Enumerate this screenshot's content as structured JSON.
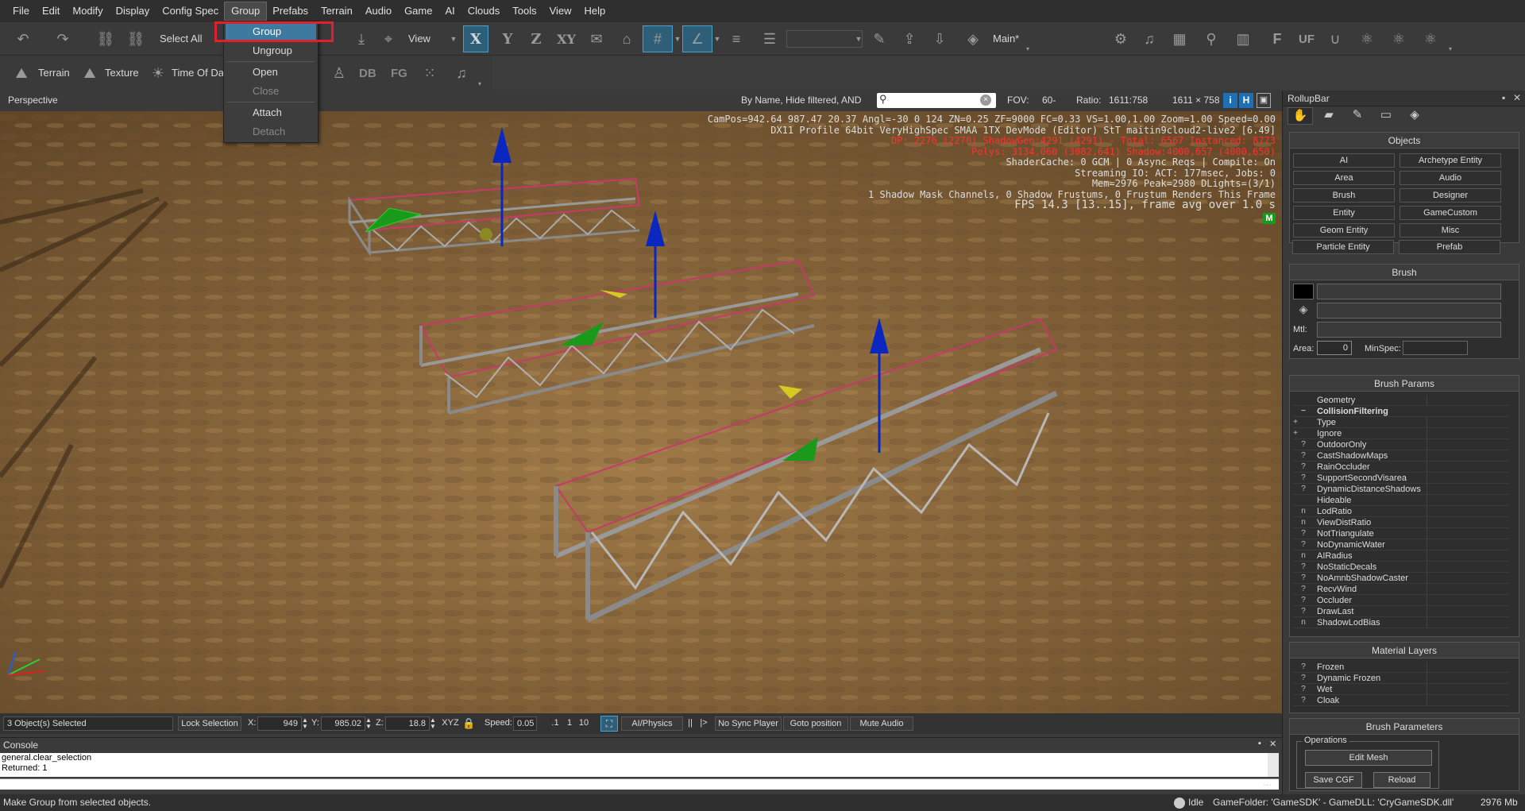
{
  "menubar": {
    "items": [
      "File",
      "Edit",
      "Modify",
      "Display",
      "Config Spec",
      "Group",
      "Prefabs",
      "Terrain",
      "Audio",
      "Game",
      "AI",
      "Clouds",
      "Tools",
      "View",
      "Help"
    ]
  },
  "group_menu": {
    "items": [
      "Group",
      "Ungroup",
      "Open",
      "Close",
      "Attach",
      "Detach"
    ]
  },
  "toolbar": {
    "select_all": "Select All",
    "view_label": "View",
    "axis_x": "X",
    "axis_y": "Y",
    "axis_z": "Z",
    "axis_xy": "XY",
    "layer_name": "Main*",
    "terrain": "Terrain",
    "texture": "Texture",
    "time_of_day": "Time Of Da",
    "db": "DB",
    "fg": "FG"
  },
  "viewport": {
    "label": "Perspective",
    "filter_text": "By Name, Hide filtered, AND",
    "fov_label": "FOV:",
    "fov_value": "60-",
    "ratio_label": "Ratio:",
    "ratio_value": "1611:758",
    "size_value": "1611 × 758",
    "btn_i": "i",
    "btn_h": "H",
    "hud_lines": [
      {
        "text": "CamPos=942.64 987.47 20.37 Angl=-30  0 124 ZN=0.25 ZF=9000 FC=0.33 VS=1.00,1.00 Zoom=1.00 Speed=0.00",
        "color": "#ffffff"
      },
      {
        "text": "DX11 Profile 64bit VeryHighSpec SMAA 1TX DevMode (Editor) StT maitin9cloud2-live2 [6.49]",
        "color": "#ffffff"
      },
      {
        "text": "DP: 2276 (2270) ShadowGen:4291 (4291) - Total: 6567 Instanced: 8773",
        "color": "#ff3030"
      },
      {
        "text": "Polys: 3134,060 (3082,641) Shadow:4000,657 (4000,650)",
        "color": "#ff3030"
      },
      {
        "text": "ShaderCache: 0 GCM | 0 Async Reqs | Compile: On",
        "color": "#ffffff"
      },
      {
        "text": "Streaming IO: ACT: 177msec, Jobs: 0",
        "color": "#ffffff"
      },
      {
        "text": "Mem=2976 Peak=2980 DLights=(3/1)",
        "color": "#ffffff"
      },
      {
        "text": "1 Shadow Mask Channels,   0 Shadow Frustums,   0 Frustum Renders This Frame",
        "color": "#ffffff"
      },
      {
        "text": "FPS 14.3 [13..15], frame avg over 1.0 s",
        "color": "#ffffff"
      }
    ],
    "hud_badge": "M"
  },
  "rollup": {
    "title": "RollupBar",
    "objects_title": "Objects",
    "objects": [
      "AI",
      "Archetype Entity",
      "Area",
      "Audio",
      "Brush",
      "Designer",
      "Entity",
      "GameCustom",
      "Geom Entity",
      "Misc",
      "Particle Entity",
      "Prefab"
    ],
    "brush_title": "Brush",
    "mtl_label": "Mtl:",
    "area_label": "Area:",
    "area_value": "0",
    "minspec_label": "MinSpec:",
    "brush_params_title": "Brush Params",
    "brush_params": [
      {
        "icon": "",
        "label": "Geometry"
      },
      {
        "icon": "−",
        "label": "CollisionFiltering"
      },
      {
        "icon": "+",
        "label": "Type"
      },
      {
        "icon": "+",
        "label": "Ignore"
      },
      {
        "icon": "?",
        "label": "OutdoorOnly"
      },
      {
        "icon": "?",
        "label": "CastShadowMaps"
      },
      {
        "icon": "?",
        "label": "RainOccluder"
      },
      {
        "icon": "?",
        "label": "SupportSecondVisarea"
      },
      {
        "icon": "?",
        "label": "DynamicDistanceShadows"
      },
      {
        "icon": "",
        "label": "Hideable"
      },
      {
        "icon": "n",
        "label": "LodRatio"
      },
      {
        "icon": "n",
        "label": "ViewDistRatio"
      },
      {
        "icon": "?",
        "label": "NotTriangulate"
      },
      {
        "icon": "?",
        "label": "NoDynamicWater"
      },
      {
        "icon": "n",
        "label": "AIRadius"
      },
      {
        "icon": "?",
        "label": "NoStaticDecals"
      },
      {
        "icon": "?",
        "label": "NoAmnbShadowCaster"
      },
      {
        "icon": "?",
        "label": "RecvWind"
      },
      {
        "icon": "?",
        "label": "Occluder"
      },
      {
        "icon": "?",
        "label": "DrawLast"
      },
      {
        "icon": "n",
        "label": "ShadowLodBias"
      }
    ],
    "material_layers_title": "Material Layers",
    "material_layers": [
      {
        "icon": "?",
        "label": "Frozen"
      },
      {
        "icon": "?",
        "label": "Dynamic Frozen"
      },
      {
        "icon": "?",
        "label": "Wet"
      },
      {
        "icon": "?",
        "label": "Cloak"
      }
    ],
    "brush_parameters_title": "Brush Parameters",
    "operations_label": "Operations",
    "edit_mesh": "Edit Mesh",
    "save_cgf": "Save CGF",
    "reload": "Reload"
  },
  "status_row": {
    "selected": "3 Object(s) Selected",
    "lock_selection": "Lock Selection",
    "x_label": "X:",
    "x_value": "949",
    "y_label": "Y:",
    "y_value": "985.02",
    "z_label": "Z:",
    "z_value": "18.8",
    "xyz": "XYZ",
    "speed_label": "Speed:",
    "speed_value": "0.05",
    "speed_01": ".1",
    "speed_1": "1",
    "speed_10": "10",
    "ai_physics": "AI/Physics",
    "no_sync": "No Sync Player",
    "goto": "Goto position",
    "mute": "Mute Audio"
  },
  "console": {
    "title": "Console",
    "lines": [
      "general.clear_selection",
      "Returned: 1"
    ]
  },
  "statusbar": {
    "hint": "Make Group from selected objects.",
    "idle": "Idle",
    "gamefolder": "GameFolder: 'GameSDK' - GameDLL: 'CryGameSDK.dll'",
    "memory": "2976 Mb"
  },
  "colors": {
    "accent": "#3e7aa0",
    "highlight_box": "#e0202e",
    "hud_red": "#ff3030"
  }
}
